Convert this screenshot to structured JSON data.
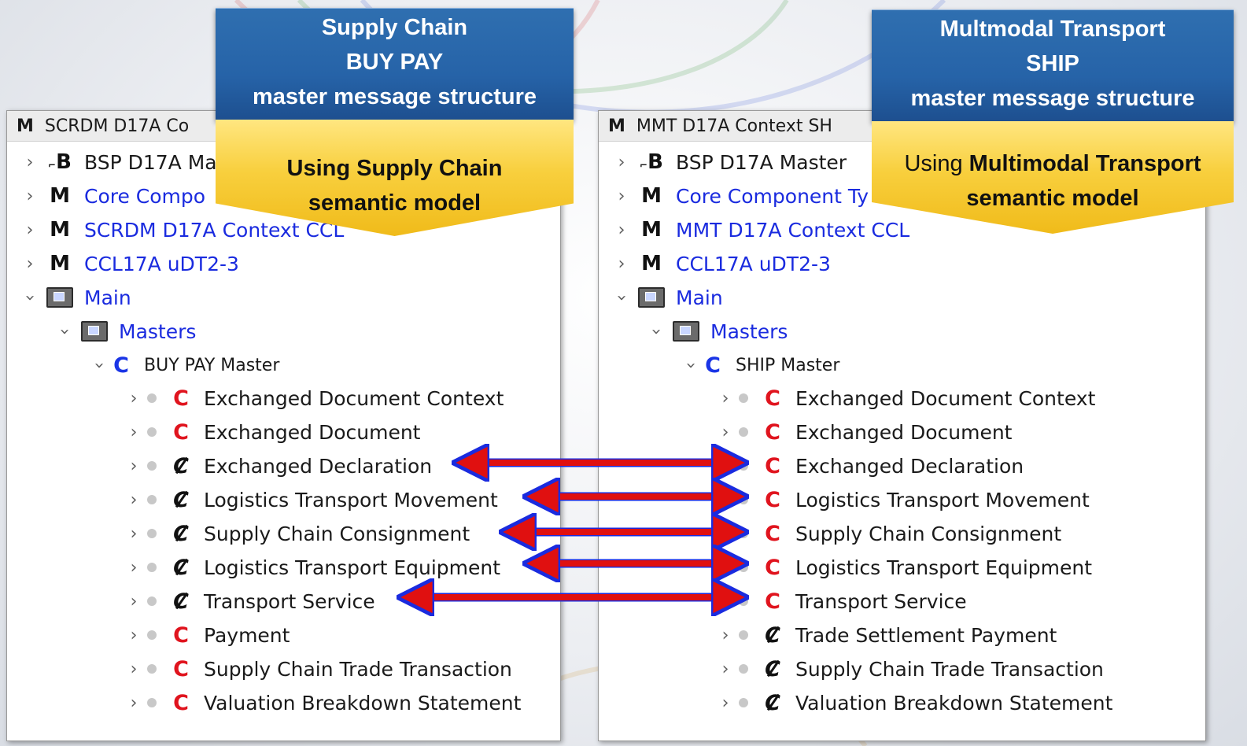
{
  "left_panel": {
    "header_glyph": "M",
    "header_title": "SCRDM D17A Co",
    "rows": [
      {
        "glyph": "B",
        "label": "BSP D17A Ma"
      },
      {
        "glyph": "M",
        "label": "Core Compo"
      },
      {
        "glyph": "M",
        "label": "SCRDM D17A Context CCL"
      },
      {
        "glyph": "M",
        "label": "CCL17A uDT2-3"
      },
      {
        "label": "Main"
      },
      {
        "label": "Masters"
      },
      {
        "glyph": "C",
        "label": "BUY PAY Master"
      }
    ],
    "classes": [
      {
        "glyph": "C",
        "label": "Exchanged Document Context"
      },
      {
        "glyph": "C",
        "label": "Exchanged Document"
      },
      {
        "glyph": "C",
        "label": "Exchanged Declaration"
      },
      {
        "glyph": "C",
        "label": "Logistics Transport Movement"
      },
      {
        "glyph": "C",
        "label": "Supply Chain Consignment"
      },
      {
        "glyph": "C",
        "label": "Logistics Transport Equipment"
      },
      {
        "glyph": "C",
        "label": "Transport Service"
      },
      {
        "glyph": "C",
        "label": "Payment"
      },
      {
        "glyph": "C",
        "label": "Supply Chain Trade Transaction"
      },
      {
        "glyph": "C",
        "label": "Valuation Breakdown Statement"
      }
    ]
  },
  "right_panel": {
    "header_glyph": "M",
    "header_title": "MMT D17A Context SH",
    "rows": [
      {
        "glyph": "B",
        "label": "BSP D17A Master"
      },
      {
        "glyph": "M",
        "label": "Core Component Ty"
      },
      {
        "glyph": "M",
        "label": "MMT D17A Context CCL"
      },
      {
        "glyph": "M",
        "label": "CCL17A uDT2-3"
      },
      {
        "label": "Main"
      },
      {
        "label": "Masters"
      },
      {
        "glyph": "C",
        "label": "SHIP Master"
      }
    ],
    "classes": [
      {
        "glyph": "C",
        "label": "Exchanged Document Context"
      },
      {
        "glyph": "C",
        "label": "Exchanged Document"
      },
      {
        "glyph": "C",
        "label": "Exchanged Declaration"
      },
      {
        "glyph": "C",
        "label": "Logistics Transport Movement"
      },
      {
        "glyph": "C",
        "label": "Supply Chain Consignment"
      },
      {
        "glyph": "C",
        "label": "Logistics Transport Equipment"
      },
      {
        "glyph": "C",
        "label": "Transport Service"
      },
      {
        "glyph": "C",
        "label": "Trade Settlement Payment"
      },
      {
        "glyph": "C",
        "label": "Supply Chain Trade Transaction"
      },
      {
        "glyph": "C",
        "label": "Valuation Breakdown Statement"
      }
    ]
  },
  "callout_left": {
    "line1": "Supply Chain",
    "line2": "BUY PAY",
    "line3": "master message structure",
    "using_line1": "Using Supply Chain",
    "using_line2": "semantic model"
  },
  "callout_right": {
    "line1": "Multmodal Transport",
    "line2": "SHIP",
    "line3": "master message structure",
    "using_prefix": "Using ",
    "using_bold": "Multimodal Transport",
    "using_line2": "semantic model"
  },
  "colors": {
    "callout_blue": "#2663a8",
    "callout_yellow": "#f8cf3d",
    "class_red": "#e0141e",
    "link_blue": "#1a2bdf",
    "arrow_red": "#e01010"
  }
}
